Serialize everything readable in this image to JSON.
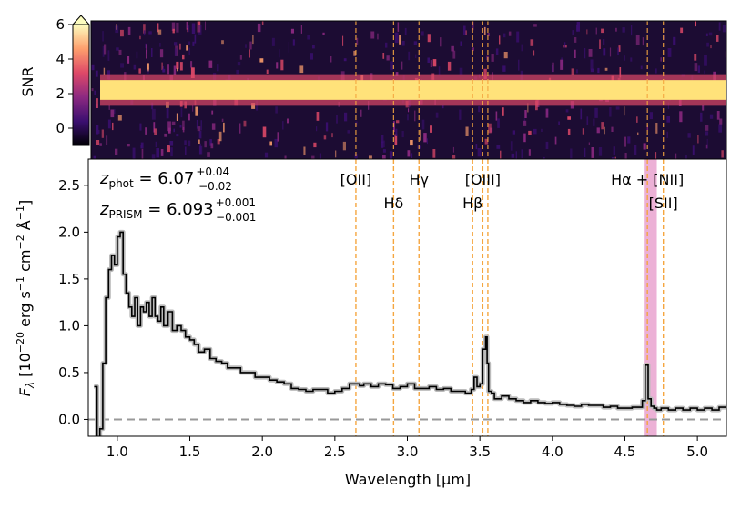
{
  "chart_data": [
    {
      "type": "heatmap",
      "panel": "snr-2d-spectrum",
      "ylabel": "SNR",
      "ylim": [
        -1,
        6
      ],
      "yticks": [
        "0",
        "2",
        "4",
        "6"
      ],
      "colormap": [
        "#000004",
        "#3b0f70",
        "#8c2981",
        "#de4968",
        "#fe9f6d",
        "#fcfdbf"
      ],
      "colorbar_extend": "max",
      "trace_color": "#ffe27a",
      "description_values": {
        "trace_row_snr_peak": 6,
        "background_snr": 0
      }
    },
    {
      "type": "line",
      "panel": "1d-spectrum",
      "xlabel": "Wavelength [μm]",
      "ylabel": "F_λ [10^-20 erg s^-1 cm^-2 Å^-1]",
      "xlim": [
        0.8,
        5.2
      ],
      "ylim": [
        -0.18,
        2.78
      ],
      "xticks": [
        "1.0",
        "1.5",
        "2.0",
        "2.5",
        "3.0",
        "3.5",
        "4.0",
        "4.5",
        "5.0"
      ],
      "yticks": [
        "0.0",
        "0.5",
        "1.0",
        "1.5",
        "2.0",
        "2.5"
      ],
      "zero_line": 0.0,
      "grid": false,
      "annotations": [
        {
          "label": "z_phot",
          "value": "6.07",
          "upper": "+0.04",
          "lower": "−0.02"
        },
        {
          "label": "z_PRISM",
          "value": "6.093",
          "upper": "+0.001",
          "lower": "−0.001"
        }
      ],
      "emission_lines": [
        {
          "name": "[OII]",
          "x": 2.645,
          "label_row": 1
        },
        {
          "name": "Hδ",
          "x": 2.905,
          "label_row": 2
        },
        {
          "name": "Hγ",
          "x": 3.08,
          "label_row": 1
        },
        {
          "name": "Hβ",
          "x": 3.45,
          "label_row": 2
        },
        {
          "name": "[OIII]",
          "x": 3.52,
          "label_row": 1
        },
        {
          "name": "",
          "x": 3.555,
          "label_row": 0
        },
        {
          "name": "Hα + [NII]",
          "x": 4.655,
          "label_row": 1
        },
        {
          "name": "[SII]",
          "x": 4.765,
          "label_row": 2
        }
      ],
      "halpha_band": [
        4.63,
        4.72
      ],
      "spectrum": {
        "x": [
          0.84,
          0.86,
          0.88,
          0.9,
          0.92,
          0.94,
          0.96,
          0.98,
          1.0,
          1.02,
          1.04,
          1.06,
          1.08,
          1.1,
          1.12,
          1.14,
          1.16,
          1.18,
          1.2,
          1.22,
          1.24,
          1.26,
          1.28,
          1.3,
          1.32,
          1.35,
          1.38,
          1.41,
          1.44,
          1.47,
          1.5,
          1.53,
          1.56,
          1.6,
          1.64,
          1.68,
          1.72,
          1.76,
          1.8,
          1.85,
          1.9,
          1.95,
          2.0,
          2.05,
          2.1,
          2.15,
          2.2,
          2.25,
          2.3,
          2.35,
          2.4,
          2.45,
          2.5,
          2.55,
          2.6,
          2.64,
          2.67,
          2.7,
          2.75,
          2.8,
          2.85,
          2.9,
          2.95,
          3.0,
          3.05,
          3.1,
          3.15,
          3.2,
          3.25,
          3.3,
          3.35,
          3.4,
          3.44,
          3.46,
          3.48,
          3.5,
          3.52,
          3.54,
          3.55,
          3.56,
          3.58,
          3.6,
          3.65,
          3.7,
          3.75,
          3.8,
          3.85,
          3.9,
          3.95,
          4.0,
          4.05,
          4.1,
          4.15,
          4.2,
          4.25,
          4.3,
          4.35,
          4.4,
          4.45,
          4.5,
          4.55,
          4.6,
          4.62,
          4.64,
          4.66,
          4.68,
          4.7,
          4.72,
          4.75,
          4.8,
          4.85,
          4.9,
          4.95,
          5.0,
          5.05,
          5.1,
          5.15,
          5.2
        ],
        "y": [
          0.35,
          -0.3,
          -0.1,
          0.6,
          1.3,
          1.6,
          1.75,
          1.65,
          1.95,
          2.0,
          1.55,
          1.35,
          1.2,
          1.1,
          1.3,
          1.0,
          1.2,
          1.15,
          1.25,
          1.1,
          1.3,
          1.1,
          1.05,
          1.2,
          1.0,
          1.15,
          0.95,
          1.0,
          0.95,
          0.88,
          0.85,
          0.8,
          0.72,
          0.75,
          0.65,
          0.62,
          0.6,
          0.55,
          0.55,
          0.5,
          0.5,
          0.45,
          0.45,
          0.42,
          0.4,
          0.38,
          0.33,
          0.32,
          0.3,
          0.32,
          0.32,
          0.28,
          0.3,
          0.33,
          0.38,
          0.38,
          0.36,
          0.38,
          0.35,
          0.38,
          0.37,
          0.33,
          0.35,
          0.38,
          0.33,
          0.33,
          0.35,
          0.32,
          0.33,
          0.3,
          0.3,
          0.28,
          0.32,
          0.45,
          0.35,
          0.38,
          0.75,
          0.88,
          0.6,
          0.3,
          0.28,
          0.22,
          0.25,
          0.22,
          0.2,
          0.18,
          0.2,
          0.18,
          0.17,
          0.18,
          0.16,
          0.15,
          0.14,
          0.16,
          0.15,
          0.15,
          0.13,
          0.14,
          0.12,
          0.12,
          0.13,
          0.13,
          0.2,
          0.58,
          0.22,
          0.14,
          0.12,
          0.1,
          0.12,
          0.1,
          0.12,
          0.1,
          0.12,
          0.1,
          0.12,
          0.1,
          0.13,
          0.15
        ],
        "color": "#000000",
        "error_color": "#bbbbbb"
      }
    }
  ]
}
